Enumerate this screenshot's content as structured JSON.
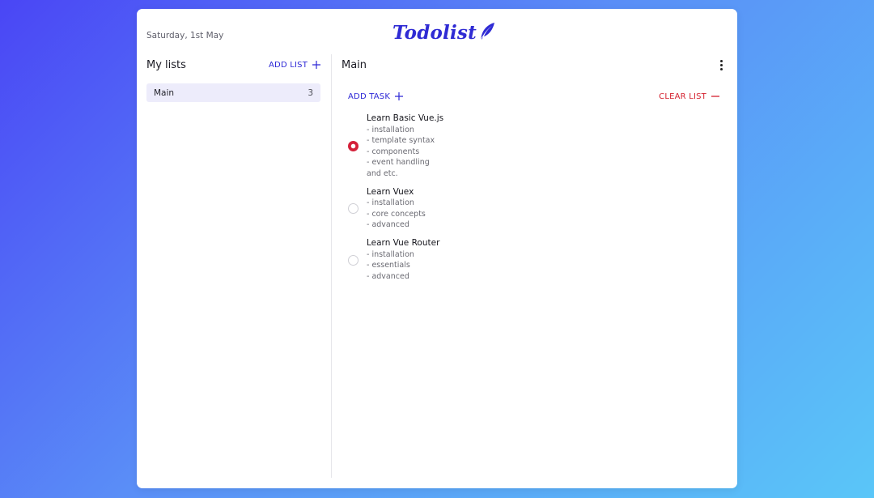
{
  "header": {
    "date": "Saturday, 1st May",
    "logo": "Todolist"
  },
  "sidebar": {
    "title": "My lists",
    "add_label": "ADD LIST",
    "lists": [
      {
        "name": "Main",
        "count": "3"
      }
    ]
  },
  "main": {
    "title": "Main",
    "add_task_label": "ADD TASK",
    "clear_label": "CLEAR LIST",
    "tasks": [
      {
        "title": "Learn Basic Vue.js",
        "desc": "- installation\n- template syntax\n- components\n- event handling\nand etc.",
        "checked": true
      },
      {
        "title": "Learn Vuex",
        "desc": "- installation\n- core concepts\n- advanced",
        "checked": false
      },
      {
        "title": "Learn Vue Router",
        "desc": "- installation\n- essentials\n- advanced",
        "checked": false
      }
    ]
  },
  "colors": {
    "accent": "#2d28d6",
    "danger": "#d4212f",
    "list_selected_bg": "#edecfb"
  },
  "icons": [
    "feather-icon",
    "plus-icon",
    "minus-icon",
    "kebab-menu-icon"
  ]
}
